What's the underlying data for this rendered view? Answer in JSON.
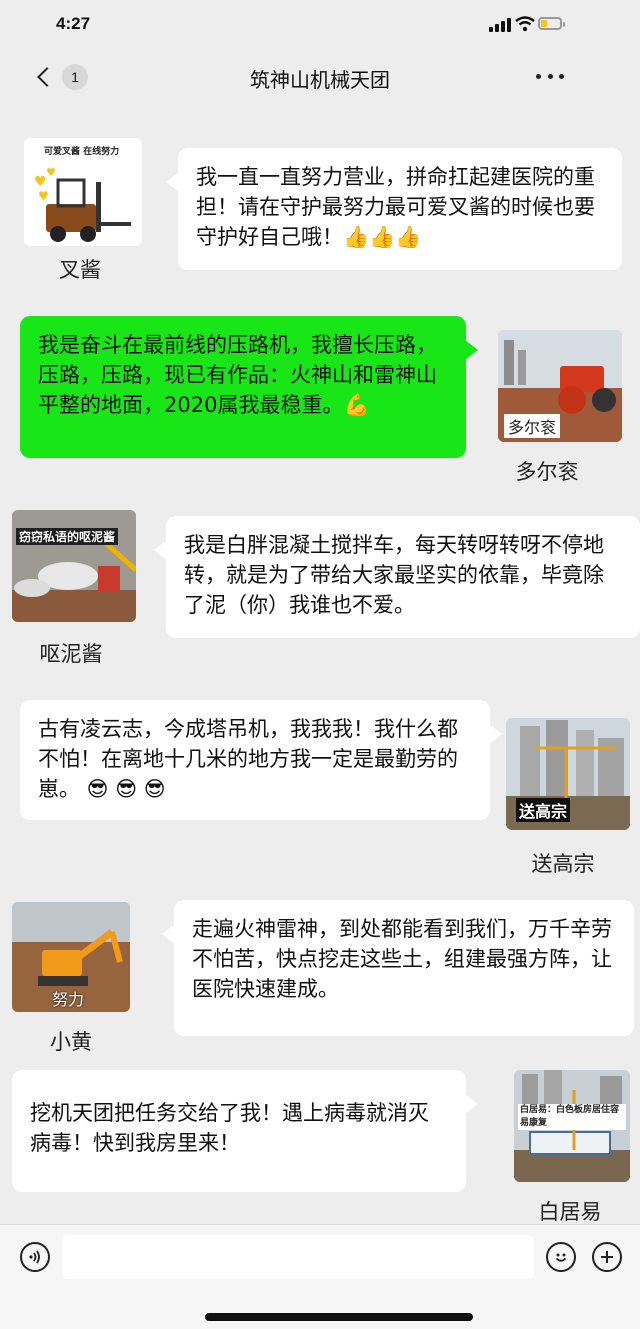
{
  "status": {
    "time": "4:27"
  },
  "nav": {
    "back_badge": "1",
    "title": "筑神山机械天团"
  },
  "messages": [
    {
      "sender": "叉酱",
      "avatar_tag": "可爱叉酱 在线努力",
      "text": "我一直一直努力营业，拼命扛起建医院的重担！请在守护最努力最可爱叉酱的时候也要守护好自己哦！👍👍👍"
    },
    {
      "sender": "多尔衮",
      "avatar_tag": "多尔衮",
      "text": "我是奋斗在最前线的压路机，我擅长压路，压路，压路，现已有作品：火神山和雷神山平整的地面，2020属我最稳重。💪"
    },
    {
      "sender": "呕泥酱",
      "avatar_tag": "窃窃私语的呕泥酱",
      "text": "我是白胖混凝土搅拌车，每天转呀转呀不停地转，就是为了带给大家最坚实的依靠，毕竟除了泥（你）我谁也不爱。"
    },
    {
      "sender": "送高宗",
      "avatar_tag": "送高宗",
      "text": "古有凌云志，今成塔吊机，我我我！我什么都不怕！在离地十几米的地方我一定是最勤劳的崽。 😎 😎 😎"
    },
    {
      "sender": "小黄",
      "avatar_tag": "努力",
      "text": "走遍火神雷神，到处都能看到我们，万千辛劳不怕苦，快点挖走这些土，组建最强方阵，让医院快速建成。"
    },
    {
      "sender": "白居易",
      "avatar_tag": "白居易：白色板房居住容易康复",
      "text": "挖机天团把任务交给了我！遇上病毒就消灭病毒！快到我房里来！"
    }
  ],
  "input": {
    "value": "",
    "placeholder": ""
  },
  "colors": {
    "background": "#ededed",
    "green_bubble": "#18e617",
    "white_bubble": "#ffffff"
  },
  "icons": [
    "back-chevron-icon",
    "more-dots-icon",
    "voice-icon",
    "emoji-icon",
    "plus-icon",
    "signal-icon",
    "wifi-icon",
    "battery-icon"
  ]
}
